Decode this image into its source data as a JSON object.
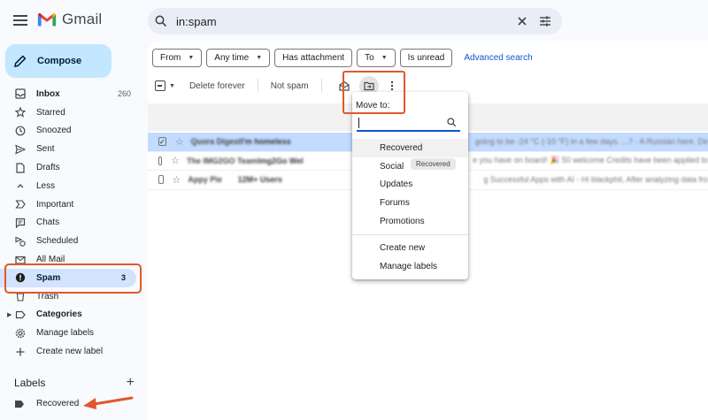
{
  "app": {
    "name": "Gmail"
  },
  "search": {
    "query": "in:spam"
  },
  "compose": {
    "label": "Compose"
  },
  "nav": {
    "items": [
      {
        "label": "Inbox",
        "count": "260",
        "icon": "inbox-icon",
        "bold": true
      },
      {
        "label": "Starred",
        "count": "",
        "icon": "star-icon"
      },
      {
        "label": "Snoozed",
        "count": "",
        "icon": "clock-icon"
      },
      {
        "label": "Sent",
        "count": "",
        "icon": "send-icon"
      },
      {
        "label": "Drafts",
        "count": "",
        "icon": "draft-icon"
      },
      {
        "label": "Less",
        "count": "",
        "icon": "chevron-up-icon"
      },
      {
        "label": "Important",
        "count": "",
        "icon": "important-icon"
      },
      {
        "label": "Chats",
        "count": "",
        "icon": "chat-icon"
      },
      {
        "label": "Scheduled",
        "count": "",
        "icon": "scheduled-icon"
      },
      {
        "label": "All Mail",
        "count": "",
        "icon": "all-mail-icon"
      },
      {
        "label": "Spam",
        "count": "3",
        "icon": "spam-icon",
        "active": true
      },
      {
        "label": "Trash",
        "count": "",
        "icon": "trash-icon"
      },
      {
        "label": "Categories",
        "count": "",
        "icon": "label-icon",
        "bold": true
      },
      {
        "label": "Manage labels",
        "count": "",
        "icon": "gear-icon"
      },
      {
        "label": "Create new label",
        "count": "",
        "icon": "plus-icon"
      }
    ]
  },
  "labels": {
    "heading": "Labels",
    "items": [
      {
        "label": "Recovered"
      }
    ]
  },
  "filters": {
    "from": "From",
    "any_time": "Any time",
    "has_attachment": "Has attachment",
    "to": "To",
    "is_unread": "Is unread",
    "advanced": "Advanced search"
  },
  "toolbar": {
    "delete_forever": "Delete forever",
    "not_spam": "Not spam"
  },
  "emails": [
    {
      "from": "Quora Digest",
      "subject": "I'm homeless",
      "snippet": "going to be -24 °C (-10 °F) in a few days. ...? - A Russian here. De",
      "selected": true
    },
    {
      "from": "The IMG2GO Team",
      "subject": "Img2Go Wel",
      "snippet": "e you have on board! 🎉 50 welcome Credits have been applied to",
      "selected": false
    },
    {
      "from": "Appy Pie",
      "subject": "12M+ Users",
      "snippet": "g Successful Apps with AI - Hi blackphil, After analyzing data fro",
      "selected": false
    }
  ],
  "move_to": {
    "title": "Move to:",
    "items": [
      "Recovered",
      "Social",
      "Updates",
      "Forums",
      "Promotions"
    ],
    "actions": [
      "Create new",
      "Manage labels"
    ],
    "tooltip": "Recovered"
  },
  "colors": {
    "accent": "#0b57d0",
    "annotation": "#e0582b",
    "compose_bg": "#c2e7ff",
    "active_nav": "#d3e3fd"
  }
}
